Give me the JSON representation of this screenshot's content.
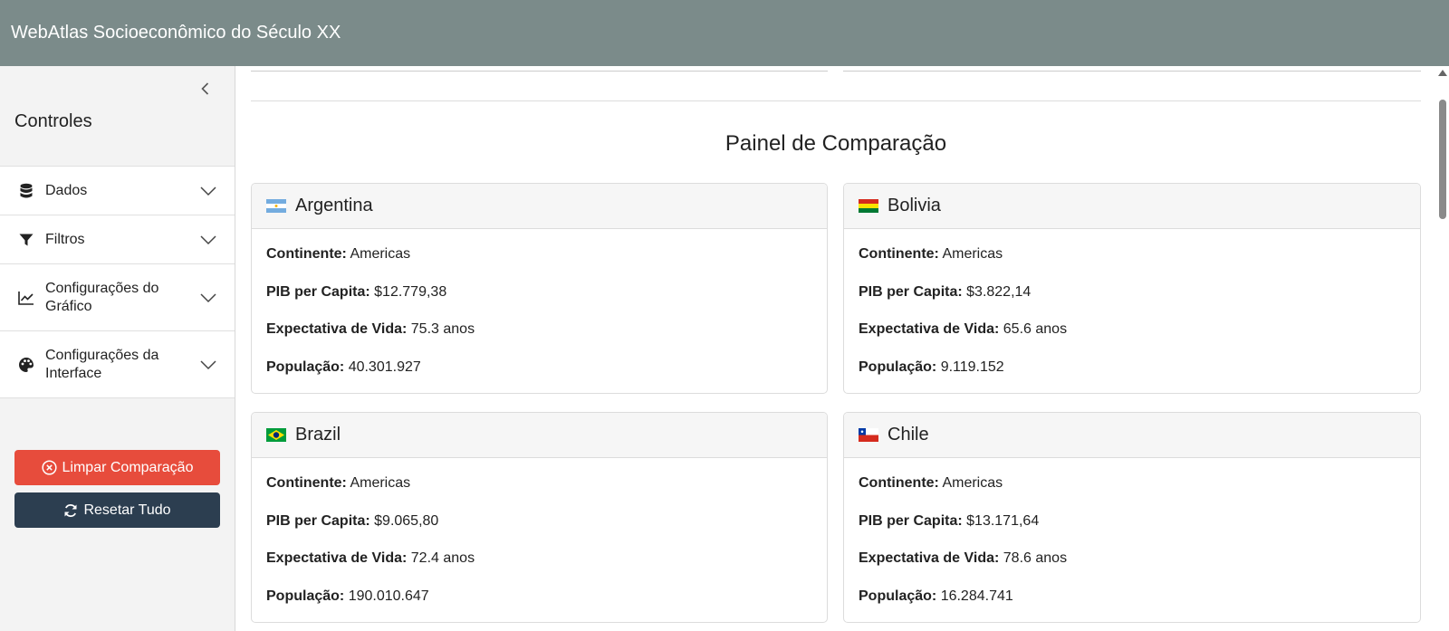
{
  "app": {
    "title": "WebAtlas Socioeconômico do Século XX"
  },
  "sidebar": {
    "title": "Controles",
    "items": [
      {
        "label": "Dados",
        "icon": "database-icon"
      },
      {
        "label": "Filtros",
        "icon": "filter-icon"
      },
      {
        "label": "Configurações do Gráfico",
        "icon": "line-chart-icon"
      },
      {
        "label": "Configurações da Interface",
        "icon": "palette-icon"
      }
    ],
    "clear_button": "Limpar Comparação",
    "reset_button": "Resetar Tudo"
  },
  "comparison": {
    "title": "Painel de Comparação",
    "labels": {
      "continent": "Continente:",
      "gdp": "PIB per Capita:",
      "life": "Expectativa de Vida:",
      "population": "População:"
    },
    "countries": [
      {
        "name": "Argentina",
        "continent": "Americas",
        "gdp": "$12.779,38",
        "life": "75.3 anos",
        "population": "40.301.927"
      },
      {
        "name": "Bolivia",
        "continent": "Americas",
        "gdp": "$3.822,14",
        "life": "65.6 anos",
        "population": "9.119.152"
      },
      {
        "name": "Brazil",
        "continent": "Americas",
        "gdp": "$9.065,80",
        "life": "72.4 anos",
        "population": "190.010.647"
      },
      {
        "name": "Chile",
        "continent": "Americas",
        "gdp": "$13.171,64",
        "life": "78.6 anos",
        "population": "16.284.741"
      }
    ]
  },
  "colors": {
    "header": "#7b8b8a",
    "clear_button": "#e74c3c",
    "reset_button": "#2c3e50"
  }
}
